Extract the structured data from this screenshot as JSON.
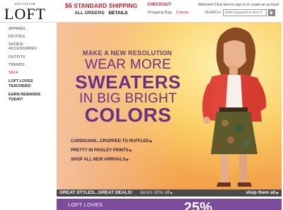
{
  "brand": {
    "top_line": "ANN TAYLOR",
    "name": "LOFT"
  },
  "shipping": {
    "amount": "$6",
    "label": "STANDARD SHIPPING",
    "sub": "ALL ORDERS",
    "details": "DETAILS"
  },
  "account": {
    "checkout": "CHECKOUT",
    "welcome": "Welcome! Click here to sign in or create an account",
    "bag_label": "Shopping Bag:",
    "bag_count": "0 Items"
  },
  "search": {
    "label": "SEARCH",
    "placeholder": "Enter keyword or item #"
  },
  "sidebar": {
    "items": [
      {
        "label": "APPAREL"
      },
      {
        "label": "PETITES"
      },
      {
        "label": "SHOES/"
      },
      {
        "label": "ACCESSORIES"
      },
      {
        "label": "OUTFITS"
      },
      {
        "label": "TRENDS"
      },
      {
        "label": "SALE"
      },
      {
        "label": "LOFT LOVES"
      },
      {
        "label": "TEACHERS!"
      },
      {
        "label": "EARN REWARDS"
      },
      {
        "label": "TODAY!"
      }
    ]
  },
  "hero": {
    "kicker": "MAKE A NEW RESOLUTION",
    "line1": "WEAR MORE",
    "line2": "SWEATERS",
    "line3": "IN BIG BRIGHT",
    "line4": "COLORS",
    "links": [
      "CARDIGANS...CROPPED TO RUFFLED",
      "PRETTY IN PAISLEY PRINTS",
      "SHOP ALL NEW ARRIVALS"
    ]
  },
  "strip": {
    "left": "GREAT STYLES...GREAT DEALS!",
    "middle": "denim 30% off",
    "right": "shop them all"
  },
  "promo": {
    "left": "LOFT LOVES",
    "percent": "25%"
  },
  "colors": {
    "accent": "#c8202f",
    "headline": "#6a2f86",
    "promo_bg": "#7c4b9c"
  }
}
